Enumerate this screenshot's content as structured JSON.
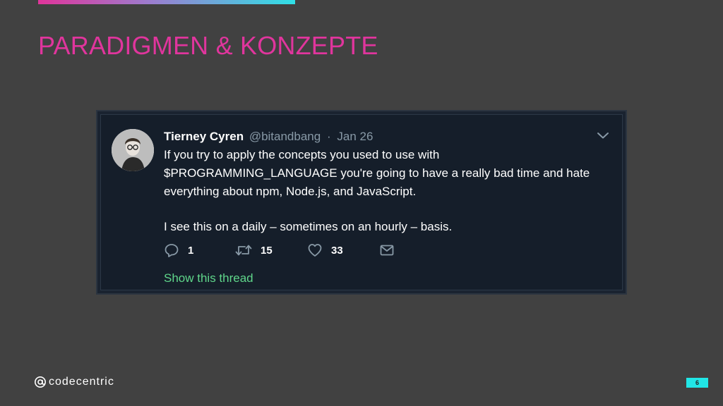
{
  "slide": {
    "title": "PARADIGMEN & KONZEPTE",
    "page_number": "6",
    "logo_text": "codecentric",
    "accent_colors": [
      "#e0359d",
      "#2fe0e6"
    ]
  },
  "tweet": {
    "author_name": "Tierney Cyren",
    "author_handle": "@bitandbang",
    "separator": "·",
    "date": "Jan 26",
    "body_lines": [
      "If you try to apply the concepts you used to use with",
      "$PROGRAMMING_LANGUAGE you're going to have a really bad time and hate",
      "everything about npm, Node.js, and JavaScript."
    ],
    "body_line2": "I see this on a daily – sometimes on an hourly – basis.",
    "actions": {
      "reply_icon": "reply-icon",
      "reply_count": "1",
      "retweet_icon": "retweet-icon",
      "retweet_count": "15",
      "like_icon": "heart-icon",
      "like_count": "33",
      "mail_icon": "mail-icon"
    },
    "thread_link": "Show this thread",
    "colors": {
      "background": "#151e2a",
      "link": "#5fd68a",
      "muted": "#8899a6"
    }
  }
}
